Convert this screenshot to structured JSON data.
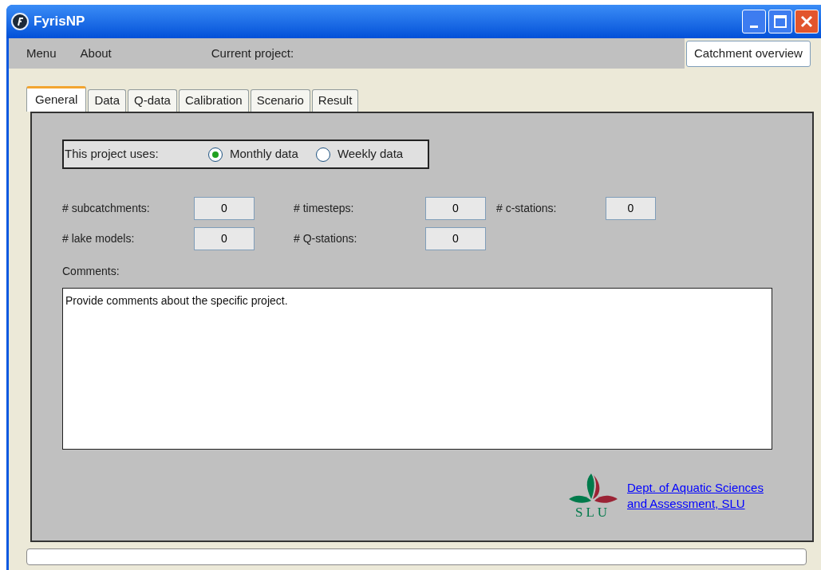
{
  "window": {
    "title": "FyrisNP"
  },
  "menu": [
    "Menu",
    "About"
  ],
  "current_project": {
    "label": "Current project:"
  },
  "catchment_button": "Catchment overview",
  "tabs": [
    {
      "label": "General",
      "selected": true
    },
    {
      "label": "Data",
      "selected": false
    },
    {
      "label": "Q-data",
      "selected": false
    },
    {
      "label": "Calibration",
      "selected": false
    },
    {
      "label": "Scenario",
      "selected": false
    },
    {
      "label": "Result",
      "selected": false
    }
  ],
  "data_type": {
    "label": "This project uses:",
    "options": [
      {
        "label": "Monthly data",
        "selected": true
      },
      {
        "label": "Weekly data",
        "selected": false
      }
    ]
  },
  "counts": [
    {
      "label": "# subcatchments:",
      "value": "0"
    },
    {
      "label": "# timesteps:",
      "value": "0"
    },
    {
      "label": "# c-stations:",
      "value": "0"
    },
    {
      "label": "# lake models:",
      "value": "0"
    },
    {
      "label": "# Q-stations:",
      "value": "0"
    }
  ],
  "comments": {
    "label": "Comments:",
    "value": "Provide comments about the specific project."
  },
  "logo": {
    "text": "SLU"
  },
  "link": {
    "lines": [
      "Dept. of Aquatic Sciences",
      "and Assessment, SLU"
    ]
  },
  "progress": {
    "level": 0
  }
}
